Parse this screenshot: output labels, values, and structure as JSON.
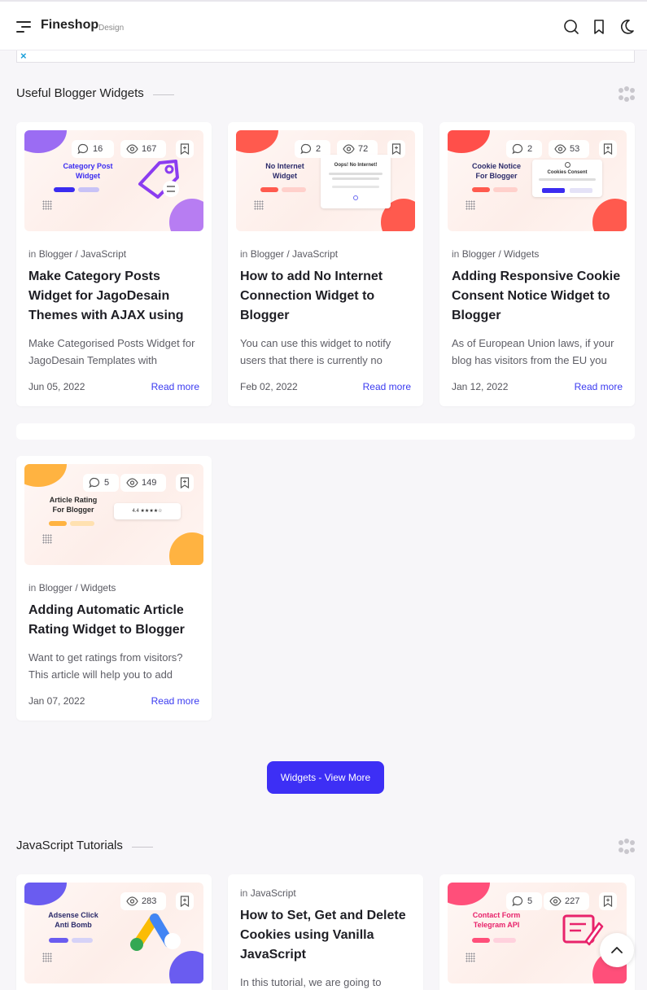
{
  "header": {
    "brand": "Fineshop",
    "brand_sub": "Design"
  },
  "ad": {
    "close_glyph": "×"
  },
  "sections": [
    {
      "title": "Useful Blogger Widgets"
    },
    {
      "title": "JavaScript Tutorials"
    }
  ],
  "widget_posts": [
    {
      "thumb": {
        "title": "Category Post\nWidget",
        "title_color": "#3b2cf0",
        "blob_a": "#9b6cf3",
        "blob_b": "#b77df2"
      },
      "comments": "16",
      "views": "167",
      "category_prefix": "in",
      "category": "Blogger / JavaScript",
      "title": "Make Category Posts Widget for JagoDesain Themes with AJAX using JavaScript",
      "snippet": "Make Categorised Posts Widget for JagoDesain Templates with JavaScript and AJAX.",
      "date": "Jun 05, 2022",
      "read_more": "Read more"
    },
    {
      "thumb": {
        "title": "No Internet\nWidget",
        "title_color": "#2b2b6a",
        "blob_a": "#ff5a4e",
        "blob_b": "#ff5a4e",
        "mini_text": "Oops! No Internet!"
      },
      "comments": "2",
      "views": "72",
      "category_prefix": "in",
      "category": "Blogger / JavaScript",
      "title": "How to add No Internet Connection Widget to Blogger",
      "snippet": "You can use this widget to notify users that there is currently no internet connection.",
      "date": "Feb 02, 2022",
      "read_more": "Read more"
    },
    {
      "thumb": {
        "title": "Cookie Notice\nFor Blogger",
        "title_color": "#2b2b6a",
        "blob_a": "#ff4f4a",
        "blob_b": "#ff5a4e",
        "mini_text": "Cookies Consent"
      },
      "comments": "2",
      "views": "53",
      "category_prefix": "in",
      "category": "Blogger / Widgets",
      "title": "Adding Responsive Cookie Consent Notice Widget to Blogger",
      "snippet": "As of European Union laws, if your blog has visitors from the EU you must show a notice.",
      "date": "Jan 12, 2022",
      "read_more": "Read more"
    },
    {
      "thumb": {
        "title": "Article Rating\nFor Blogger",
        "title_color": "#2b2b2b",
        "blob_a": "#ffb341",
        "blob_b": "#ffb341",
        "mini_text": "4.4 ★★★★☆"
      },
      "comments": "5",
      "views": "149",
      "category_prefix": "in",
      "category": "Blogger / Widgets",
      "title": "Adding Automatic Article Rating Widget to Blogger",
      "snippet": "Want to get ratings from visitors? This article will help you to add rating widget.",
      "date": "Jan 07, 2022",
      "read_more": "Read more"
    }
  ],
  "view_more": "Widgets - View More",
  "js_posts": [
    {
      "thumb": {
        "title": "Adsense Click\nAnti Bomb",
        "title_color": "#2b2b6a",
        "blob_a": "#6a5cf0",
        "blob_b": "#6a5cf0"
      },
      "views": "283"
    },
    {
      "category_prefix": "in",
      "category": "JavaScript",
      "title": "How to Set, Get and Delete Cookies using Vanilla JavaScript",
      "snippet": "In this tutorial, we are going to"
    },
    {
      "thumb": {
        "title": "Contact Form\nTelegram API",
        "title_color": "#e8236b",
        "blob_a": "#ff4f7a",
        "blob_b": "#ff4f7a"
      },
      "comments": "5",
      "views": "227"
    }
  ]
}
